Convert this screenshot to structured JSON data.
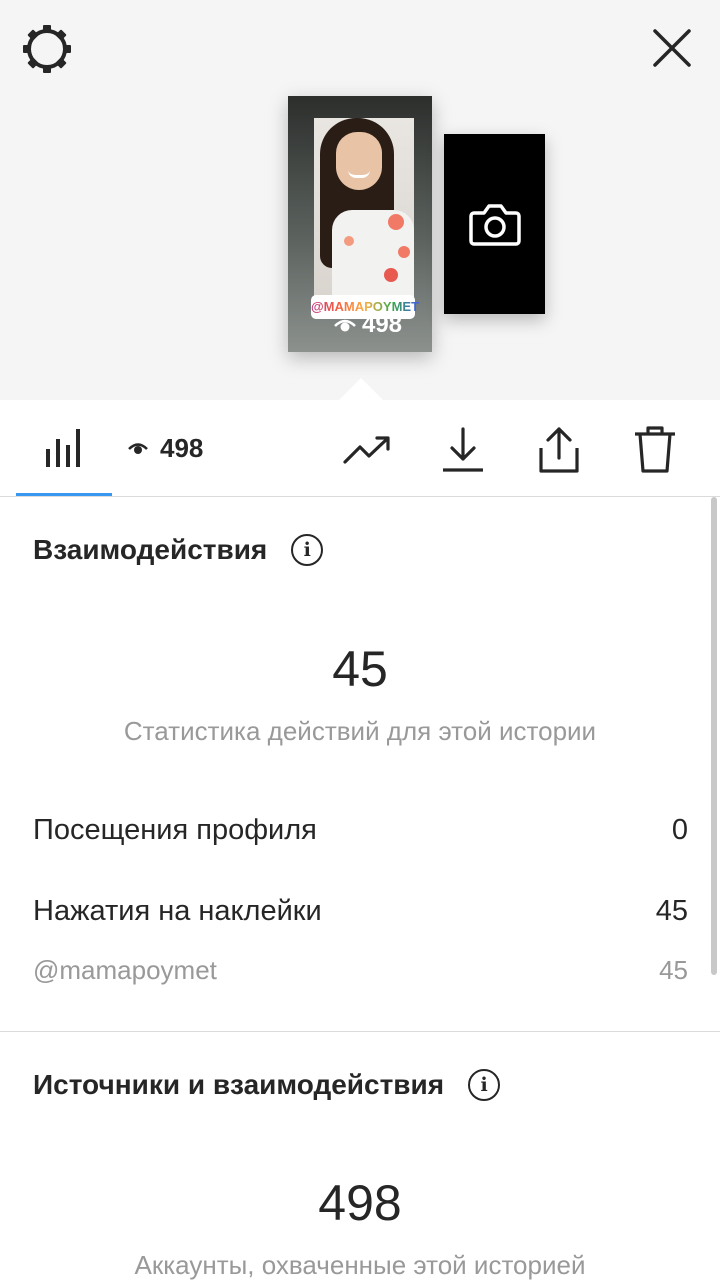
{
  "icons": {
    "settings": "gear-icon",
    "close": "close-icon",
    "camera": "camera-icon",
    "stats_tab": "bar-chart-icon",
    "views": "eye-icon",
    "promote": "trending-up-icon",
    "download": "download-icon",
    "share": "share-icon",
    "delete": "trash-icon",
    "info": "info-icon"
  },
  "story_preview": {
    "mention_sticker": "@MAMAPOYMET",
    "views": "498"
  },
  "toolbar": {
    "views": "498"
  },
  "interactions": {
    "title": "Взаимодействия",
    "info_glyph": "i",
    "total": "45",
    "caption": "Статистика действий для этой истории",
    "rows": [
      {
        "label": "Посещения профиля",
        "value": "0"
      },
      {
        "label": "Нажатия на наклейки",
        "value": "45"
      }
    ],
    "sticker_row": {
      "label": "@mamapoymet",
      "value": "45"
    }
  },
  "discovery": {
    "title": "Источники и взаимодействия",
    "info_glyph": "i",
    "total": "498",
    "caption": "Аккаунты, охваченные этой историей"
  },
  "colors": {
    "accent": "#3897f0",
    "text": "#262626",
    "secondary_text": "#999999",
    "header_bg": "#f5f5f5",
    "divider": "#dbdbdb"
  }
}
